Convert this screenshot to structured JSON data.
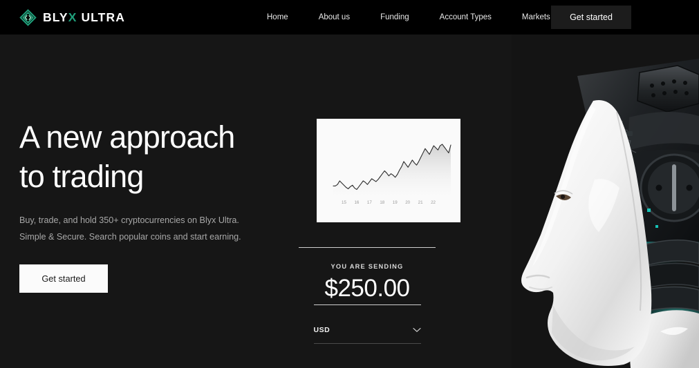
{
  "brand": {
    "name_part1": "BLY",
    "name_accent": "X",
    "name_part2": " ULTRA",
    "logo_icon": "diamond-logo-icon",
    "accent_color": "#1f9e7a"
  },
  "nav": {
    "items": [
      {
        "label": "Home"
      },
      {
        "label": "About us"
      },
      {
        "label": "Funding"
      },
      {
        "label": "Account Types"
      },
      {
        "label": "Markets"
      }
    ],
    "cta_label": "Get started"
  },
  "hero": {
    "title": "A new approach\nto trading",
    "subtitle": "Buy, trade, and hold 350+ cryptocurrencies on Blyx Ultra.\nSimple & Secure. Search popular coins and start earning.",
    "cta_label": "Get started"
  },
  "send": {
    "label": "YOU ARE SENDING",
    "amount": "$250.00",
    "currency": "USD",
    "chevron_icon": "chevron-down-icon"
  },
  "robot": {
    "alt": "white-robot-head-profile",
    "glow_color": "#16c6bd"
  },
  "chart_data": {
    "type": "area",
    "title": "",
    "xlabel": "",
    "ylabel": "",
    "categories": [
      "15",
      "16",
      "17",
      "18",
      "19",
      "20",
      "21",
      "22"
    ],
    "x": [
      0,
      1,
      2,
      3,
      4,
      5,
      6,
      7,
      8,
      9,
      10,
      11,
      12,
      13,
      14,
      15,
      16,
      17,
      18,
      19,
      20,
      21,
      22,
      23,
      24,
      25,
      26,
      27,
      28,
      29,
      30,
      31,
      32,
      33,
      34,
      35,
      36,
      37,
      38,
      39,
      40,
      41,
      42,
      43,
      44,
      45,
      46,
      47,
      48,
      49,
      50,
      51,
      52,
      53,
      54,
      55
    ],
    "values": [
      18,
      18,
      20,
      25,
      22,
      19,
      16,
      14,
      17,
      19,
      15,
      13,
      17,
      21,
      25,
      23,
      20,
      24,
      28,
      26,
      24,
      27,
      31,
      35,
      39,
      36,
      32,
      35,
      33,
      30,
      34,
      40,
      45,
      52,
      48,
      44,
      49,
      54,
      50,
      47,
      52,
      58,
      64,
      70,
      66,
      62,
      68,
      74,
      71,
      68,
      74,
      76,
      72,
      68,
      64,
      75
    ],
    "ylim": [
      0,
      100
    ],
    "grid": false,
    "legend": false,
    "line_color": "#2b2b2b",
    "fill_top": "#d5d5d5",
    "fill_bottom": "#fbfbfb"
  }
}
